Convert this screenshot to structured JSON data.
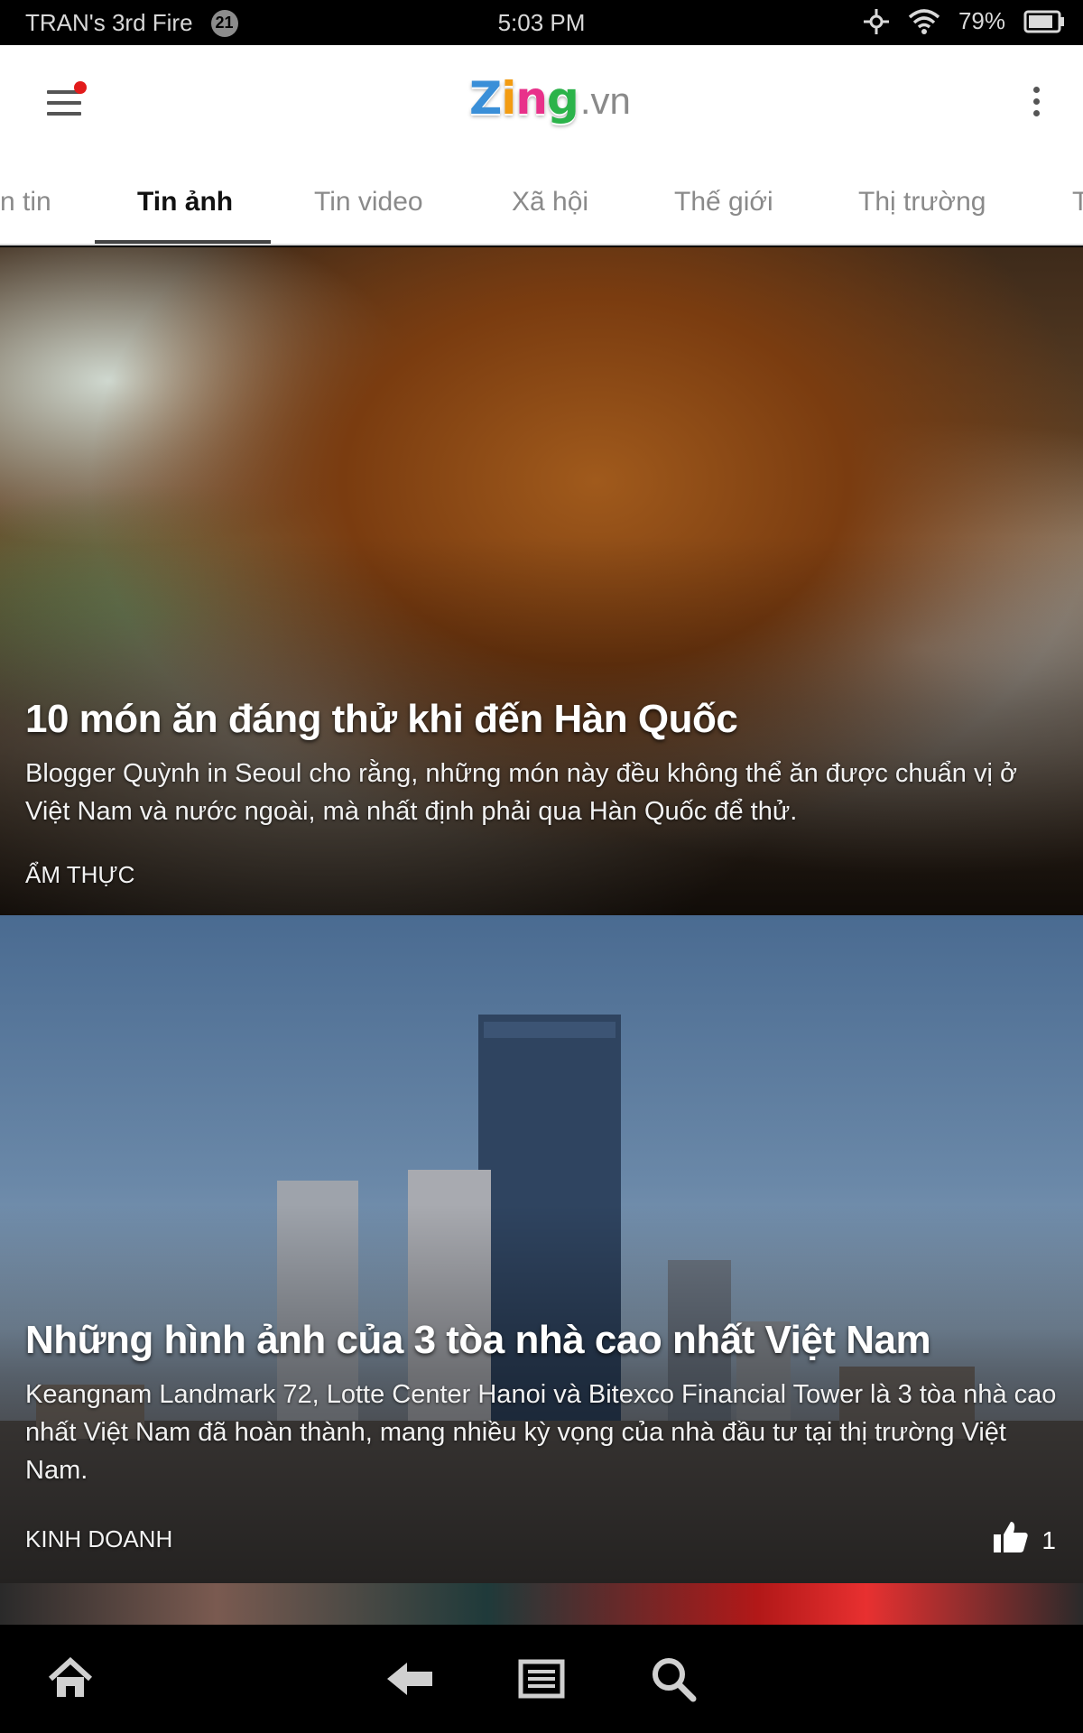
{
  "status_bar": {
    "device_name": "TRAN's 3rd Fire",
    "notification_count": "21",
    "time": "5:03 PM",
    "battery": "79%"
  },
  "app_bar": {
    "logo_main": [
      "Z",
      "i",
      "n",
      "g"
    ],
    "logo_colors": [
      "#3a8fd8",
      "#f39c12",
      "#e8318a",
      "#2bb34a"
    ],
    "logo_suffix": ".vn",
    "menu_icon": "hamburger-menu-icon",
    "more_icon": "more-vertical-icon"
  },
  "tabs": [
    {
      "label": "n tin",
      "active": false
    },
    {
      "label": "Tin ảnh",
      "active": true
    },
    {
      "label": "Tin video",
      "active": false
    },
    {
      "label": "Xã hội",
      "active": false
    },
    {
      "label": "Thế giới",
      "active": false
    },
    {
      "label": "Thị trường",
      "active": false
    },
    {
      "label": "T",
      "active": false
    }
  ],
  "articles": [
    {
      "title": "10 món ăn đáng thử khi đến Hàn Quốc",
      "description": "Blogger Quỳnh in Seoul cho rằng, những món này đều không thể ăn được chuẩn vị ở Việt Nam và nước ngoài, mà nhất định phải qua Hàn Quốc để thử.",
      "category": "ẨM THỰC"
    },
    {
      "title": "Những hình ảnh của 3 tòa nhà cao nhất Việt Nam",
      "description": " Keangnam Landmark 72, Lotte Center Hanoi và Bitexco Financial Tower là 3 tòa nhà cao nhất Việt Nam đã hoàn thành, mang nhiều kỳ vọng của nhà đầu tư tại thị trường Việt Nam.",
      "category": "KINH DOANH",
      "likes": "1"
    }
  ],
  "bottom_nav": [
    "home-icon",
    "back-icon",
    "recent-apps-icon",
    "search-icon"
  ]
}
